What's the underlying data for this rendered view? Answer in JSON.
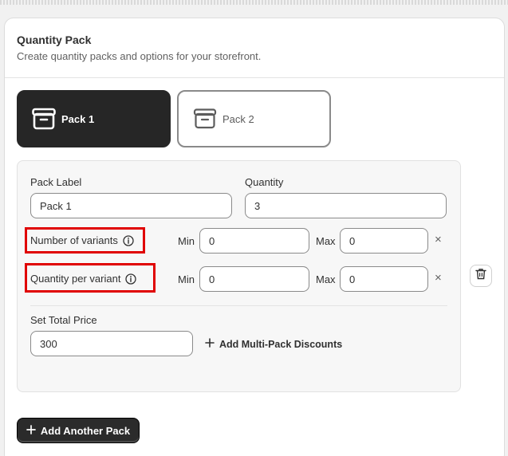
{
  "header": {
    "title": "Quantity Pack",
    "subtitle": "Create quantity packs and options for your storefront."
  },
  "tabs": [
    {
      "label": "Pack 1",
      "active": true,
      "icon": "box-icon"
    },
    {
      "label": "Pack 2",
      "active": false,
      "icon": "box-icon"
    }
  ],
  "pack": {
    "pack_label_label": "Pack Label",
    "pack_label_value": "Pack 1",
    "quantity_label": "Quantity",
    "quantity_value": "3",
    "variants": {
      "label": "Number of variants",
      "min_label": "Min",
      "min_value": "0",
      "max_label": "Max",
      "max_value": "0",
      "clear_glyph": "×"
    },
    "per_variant": {
      "label": "Quantity per variant",
      "min_label": "Min",
      "min_value": "0",
      "max_label": "Max",
      "max_value": "0",
      "clear_glyph": "×"
    },
    "total_price_label": "Set Total Price",
    "total_price_value": "300",
    "multi_pack_label": "Add Multi-Pack Discounts"
  },
  "actions": {
    "add_pack_label": "Add Another Pack"
  },
  "colors": {
    "highlight": "#e00000",
    "active_tab": "#262626",
    "panel_bg": "#f7f7f7"
  }
}
